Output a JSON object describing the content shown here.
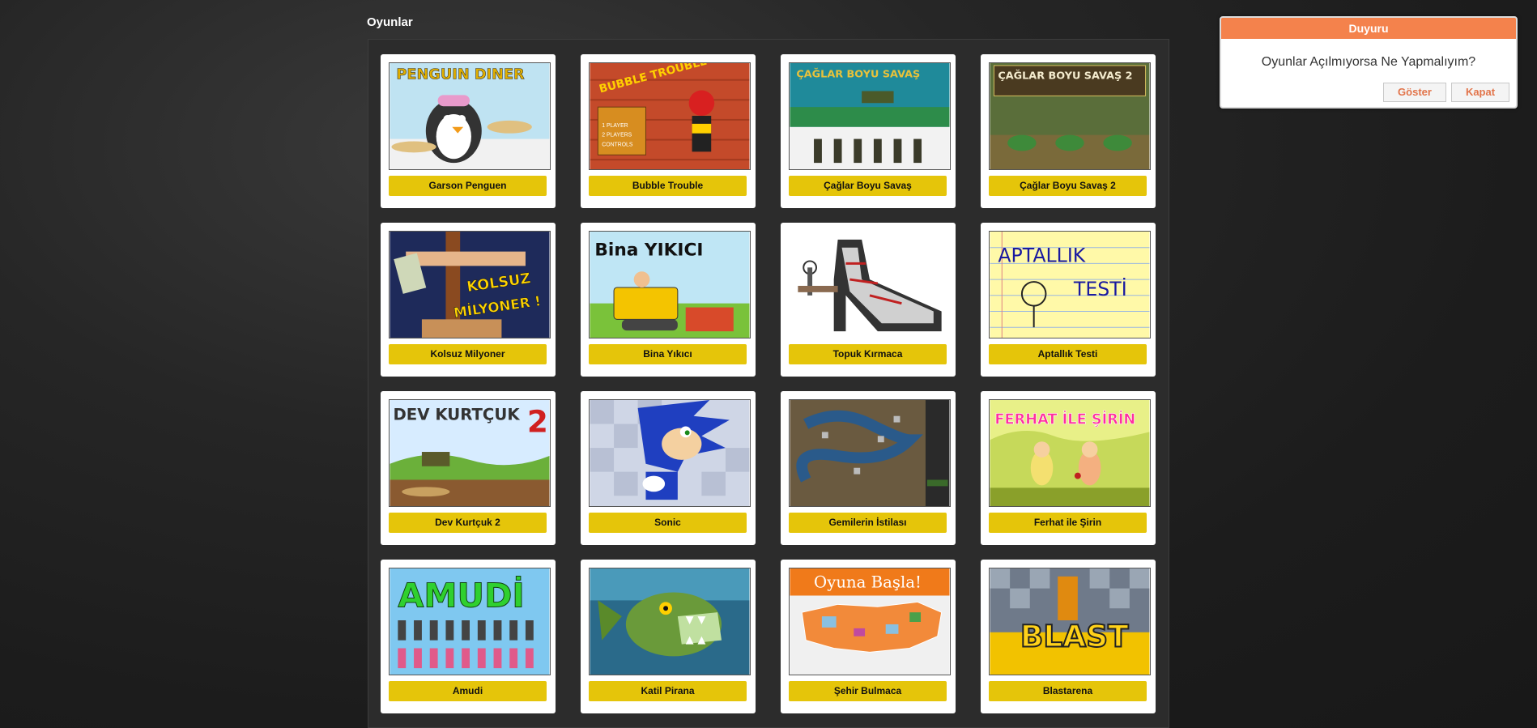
{
  "page": {
    "title": "Oyunlar"
  },
  "colors": {
    "label_bg": "#e5c50a",
    "notice_header": "#f4824c",
    "notice_button_text": "#e2744a"
  },
  "games": [
    {
      "label": "Garson Penguen",
      "thumb_text": "PENGUIN DINER",
      "thumb_bg": "#bfe3f2"
    },
    {
      "label": "Bubble Trouble",
      "thumb_text": "BUBBLE TROUBLE",
      "thumb_bg": "#c44a2a"
    },
    {
      "label": "Çağlar Boyu Savaş",
      "thumb_text": "ÇAĞLAR BOYU SAVAŞ",
      "thumb_bg": "#1f8a9a"
    },
    {
      "label": "Çağlar Boyu Savaş 2",
      "thumb_text": "ÇAĞLAR BOYU SAVAŞ 2",
      "thumb_bg": "#5a6e3a"
    },
    {
      "label": "Kolsuz Milyoner",
      "thumb_text": "KOLSUZ MİLYONER !",
      "thumb_bg": "#1e2a5a"
    },
    {
      "label": "Bina Yıkıcı",
      "thumb_text": "Bina YIKICI",
      "thumb_bg": "#bfe6f5"
    },
    {
      "label": "Topuk Kırmaca",
      "thumb_text": "",
      "thumb_bg": "#ffffff"
    },
    {
      "label": "Aptallık Testi",
      "thumb_text": "APTALLIK TESTİ",
      "thumb_bg": "#fff9a8"
    },
    {
      "label": "Dev Kurtçuk 2",
      "thumb_text": "DEV KURTÇUK 2",
      "thumb_bg": "#d7ecff"
    },
    {
      "label": "Sonic",
      "thumb_text": "",
      "thumb_bg": "#cfd6e6"
    },
    {
      "label": "Gemilerin İstilası",
      "thumb_text": "",
      "thumb_bg": "#6a5a40"
    },
    {
      "label": "Ferhat ile Şirin",
      "thumb_text": "FERHAT İLE ŞİRİN",
      "thumb_bg": "#c6d95a"
    },
    {
      "label": "Amudi",
      "thumb_text": "AMUDİ",
      "thumb_bg": "#7fc8f0"
    },
    {
      "label": "Katil Pirana",
      "thumb_text": "",
      "thumb_bg": "#2a6a8a"
    },
    {
      "label": "Şehir Bulmaca",
      "thumb_text": "Oyuna Başla!",
      "thumb_bg": "#f0f0f0"
    },
    {
      "label": "Blastarena",
      "thumb_text": "BLAST",
      "thumb_bg": "#6f7a8a"
    }
  ],
  "notice": {
    "title": "Duyuru",
    "message": "Oyunlar Açılmıyorsa Ne Yapmalıyım?",
    "show_label": "Göster",
    "close_label": "Kapat"
  }
}
